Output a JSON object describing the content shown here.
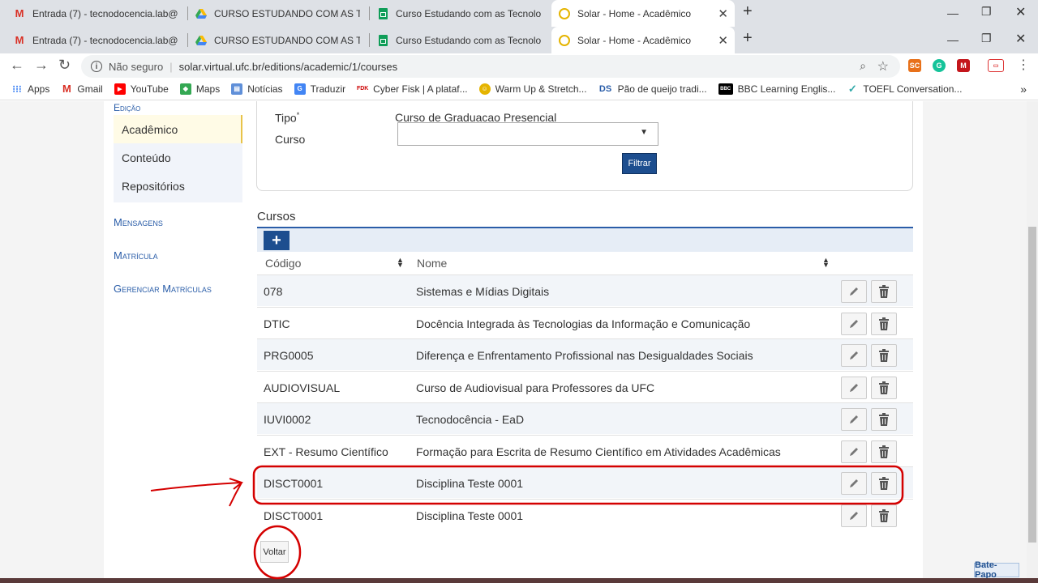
{
  "browser": {
    "tabs_row1": [
      {
        "title": "Entrada (7) - tecnodocencia.lab@",
        "icon": "gmail-icon"
      },
      {
        "title": "CURSO ESTUDANDO COM AS TE",
        "icon": "drive-icon"
      },
      {
        "title": "Curso Estudando com as Tecnolo",
        "icon": "sheets-icon"
      },
      {
        "title": "Solar - Home - Acadêmico",
        "icon": "solar-icon"
      }
    ],
    "tabs_row2": [
      {
        "title": "Entrada (7) - tecnodocencia.lab@",
        "icon": "gmail-icon"
      },
      {
        "title": "CURSO ESTUDANDO COM AS TE",
        "icon": "drive-icon"
      },
      {
        "title": "Curso Estudando com as Tecnolo",
        "icon": "sheets-icon"
      },
      {
        "title": "Solar - Home - Acadêmico",
        "icon": "solar-icon"
      }
    ],
    "security_label": "Não seguro",
    "url": "solar.virtual.ufc.br/editions/academic/1/courses",
    "bookmarks": [
      {
        "label": "Apps",
        "icon": "apps-icon"
      },
      {
        "label": "Gmail",
        "icon": "gmail-icon"
      },
      {
        "label": "YouTube",
        "icon": "youtube-icon"
      },
      {
        "label": "Maps",
        "icon": "maps-icon"
      },
      {
        "label": "Notícias",
        "icon": "news-icon"
      },
      {
        "label": "Traduzir",
        "icon": "translate-icon"
      },
      {
        "label": "Cyber Fisk | A plataf...",
        "icon": "fisk-icon"
      },
      {
        "label": "Warm Up & Stretch...",
        "icon": "warmup-icon"
      },
      {
        "label": "Pão de queijo tradi...",
        "icon": "ds-icon"
      },
      {
        "label": "BBC Learning Englis...",
        "icon": "bbc-icon"
      },
      {
        "label": "TOEFL Conversation...",
        "icon": "toefl-icon"
      }
    ],
    "overflow_label": "»"
  },
  "sidebar": {
    "section_title": "Edição",
    "items": [
      {
        "label": "Acadêmico",
        "selected": true
      },
      {
        "label": "Conteúdo",
        "selected": false
      },
      {
        "label": "Repositórios",
        "selected": false
      }
    ],
    "menus": [
      "Mensagens",
      "Matrícula",
      "Gerenciar Matrículas"
    ]
  },
  "filter": {
    "tipo_label": "Tipo",
    "required_mark": "*",
    "tipo_value": "Curso de Graduacao Presencial",
    "curso_label": "Curso",
    "curso_value": "",
    "select_arrow": "▼",
    "button_label": "Filtrar"
  },
  "courses": {
    "title": "Cursos",
    "add_label": "+",
    "col_code": "Código",
    "col_name": "Nome",
    "rows": [
      {
        "code": "078",
        "name": "Sistemas e Mídias Digitais"
      },
      {
        "code": "DTIC",
        "name": "Docência Integrada às Tecnologias da Informação e Comunicação"
      },
      {
        "code": "PRG0005",
        "name": "Diferença e Enfrentamento Profissional nas Desigualdades Sociais"
      },
      {
        "code": "AUDIOVISUAL",
        "name": "Curso de Audiovisual para Professores da UFC"
      },
      {
        "code": "IUVI0002",
        "name": "Tecnodocência - EaD"
      },
      {
        "code": "EXT - Resumo Científico",
        "name": "Formação para Escrita de Resumo Científico em Atividades Acadêmicas"
      },
      {
        "code": "DISCT0001",
        "name": "Disciplina Teste 0001"
      },
      {
        "code": "DISCT0001",
        "name": "Disciplina Teste 0001"
      }
    ]
  },
  "back_label": "Voltar",
  "chat_label": "Bate-Papo",
  "colors": {
    "accent": "#1d4e8f",
    "link": "#2a5da8",
    "annotation": "#d40000"
  }
}
